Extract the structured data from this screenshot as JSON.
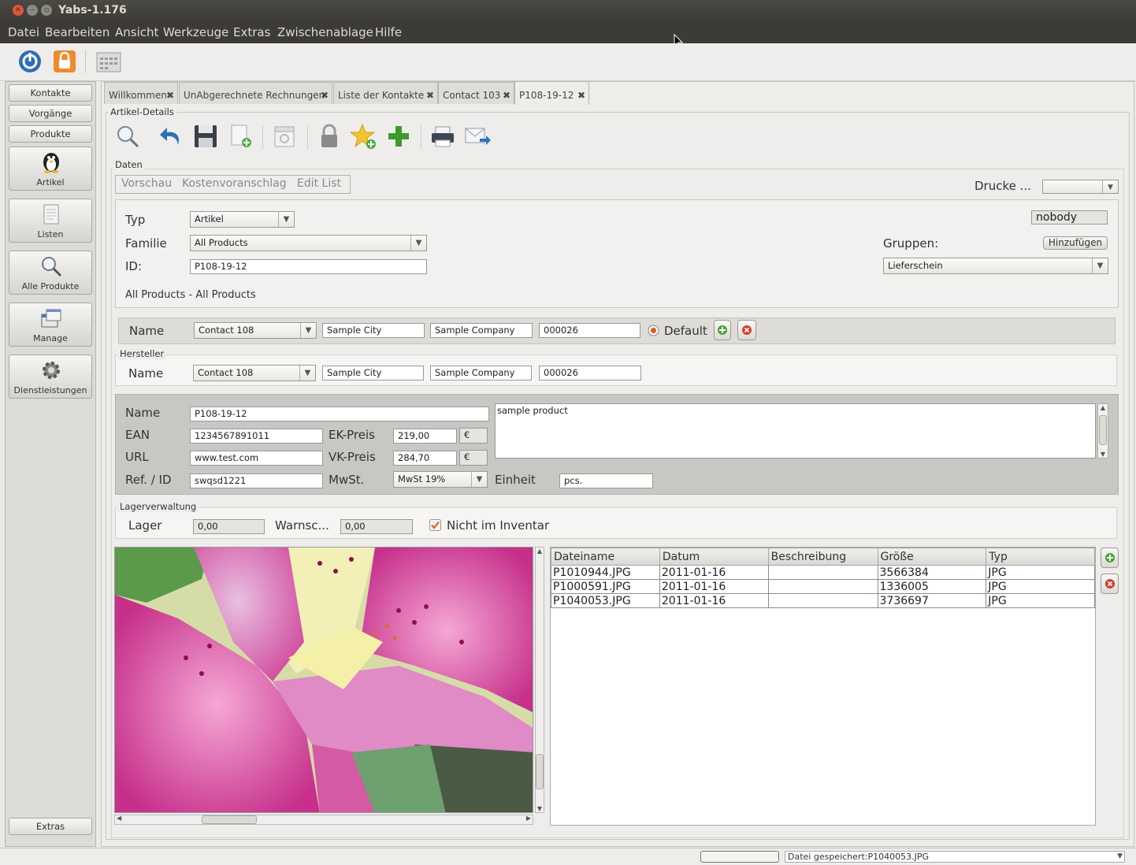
{
  "window": {
    "title": "Yabs-1.176"
  },
  "menu": [
    "Datei",
    "Bearbeiten",
    "Ansicht",
    "Werkzeuge",
    "Extras",
    "Zwischenablage",
    "Hilfe"
  ],
  "toolbar": {
    "icons": [
      "power-icon",
      "lock-icon",
      "calendar-icon"
    ]
  },
  "nav": {
    "buttons": [
      "Kontakte",
      "Vorgänge",
      "Produkte"
    ],
    "big": [
      "Artikel",
      "Listen",
      "Alle Produkte",
      "Manage",
      "Dienstleistungen"
    ],
    "extras": "Extras"
  },
  "tabs": [
    {
      "label": "Willkommen"
    },
    {
      "label": "UnAbgerechnete Rechnungen"
    },
    {
      "label": "Liste der Kontakte"
    },
    {
      "label": "Contact 103"
    },
    {
      "label": "P108-19-12"
    }
  ],
  "section": {
    "artikel_details": "Artikel-Details",
    "daten": "Daten",
    "hersteller": "Hersteller",
    "lager": "Lagerverwaltung"
  },
  "subtabs": [
    "Vorschau",
    "Kostenvoranschlag",
    "Edit List"
  ],
  "drucke": {
    "label": "Drucke ...",
    "value": ""
  },
  "top": {
    "typ_label": "Typ",
    "typ_value": "Artikel",
    "familie_label": "Familie",
    "familie_value": "All Products",
    "id_label": "ID:",
    "id_value": "P108-19-12",
    "path": "All Products - All Products",
    "user": "nobody",
    "gruppen_label": "Gruppen:",
    "hinzufuegen": "Hinzufügen",
    "gruppen_value": "Lieferschein"
  },
  "supplier": {
    "name_label": "Name",
    "contact": "Contact 108",
    "city": "Sample City",
    "company": "Sample Company",
    "number": "000026",
    "default_label": "Default"
  },
  "manufacturer": {
    "name_label": "Name",
    "contact": "Contact 108",
    "city": "Sample City",
    "company": "Sample Company",
    "number": "000026"
  },
  "product": {
    "name_label": "Name",
    "name_value": "P108-19-12",
    "ean_label": "EAN",
    "ean_value": "1234567891011",
    "url_label": "URL",
    "url_value": "www.test.com",
    "ref_label": "Ref. / ID",
    "ref_value": "swqsd1221",
    "ek_label": "EK-Preis",
    "ek_value": "219,00",
    "vk_label": "VK-Preis",
    "vk_value": "284,70",
    "currency": "€",
    "mwst_label": "MwSt.",
    "mwst_value": "MwSt 19%",
    "einheit_label": "Einheit",
    "einheit_value": "pcs.",
    "description": "sample product"
  },
  "stock": {
    "lager_label": "Lager",
    "lager_value": "0,00",
    "warn_label": "Warnsc...",
    "warn_value": "0,00",
    "inventar_label": "Nicht im Inventar"
  },
  "files": {
    "headers": [
      "Dateiname",
      "Datum",
      "Beschreibung",
      "Größe",
      "Typ"
    ],
    "rows": [
      [
        "P1010944.JPG",
        "2011-01-16",
        "",
        "3566384",
        "JPG"
      ],
      [
        "P1000591.JPG",
        "2011-01-16",
        "",
        "1336005",
        "JPG"
      ],
      [
        "P1040053.JPG",
        "2011-01-16",
        "",
        "3736697",
        "JPG"
      ]
    ]
  },
  "status": {
    "message": "Datei gespeichert:P1040053.JPG"
  }
}
